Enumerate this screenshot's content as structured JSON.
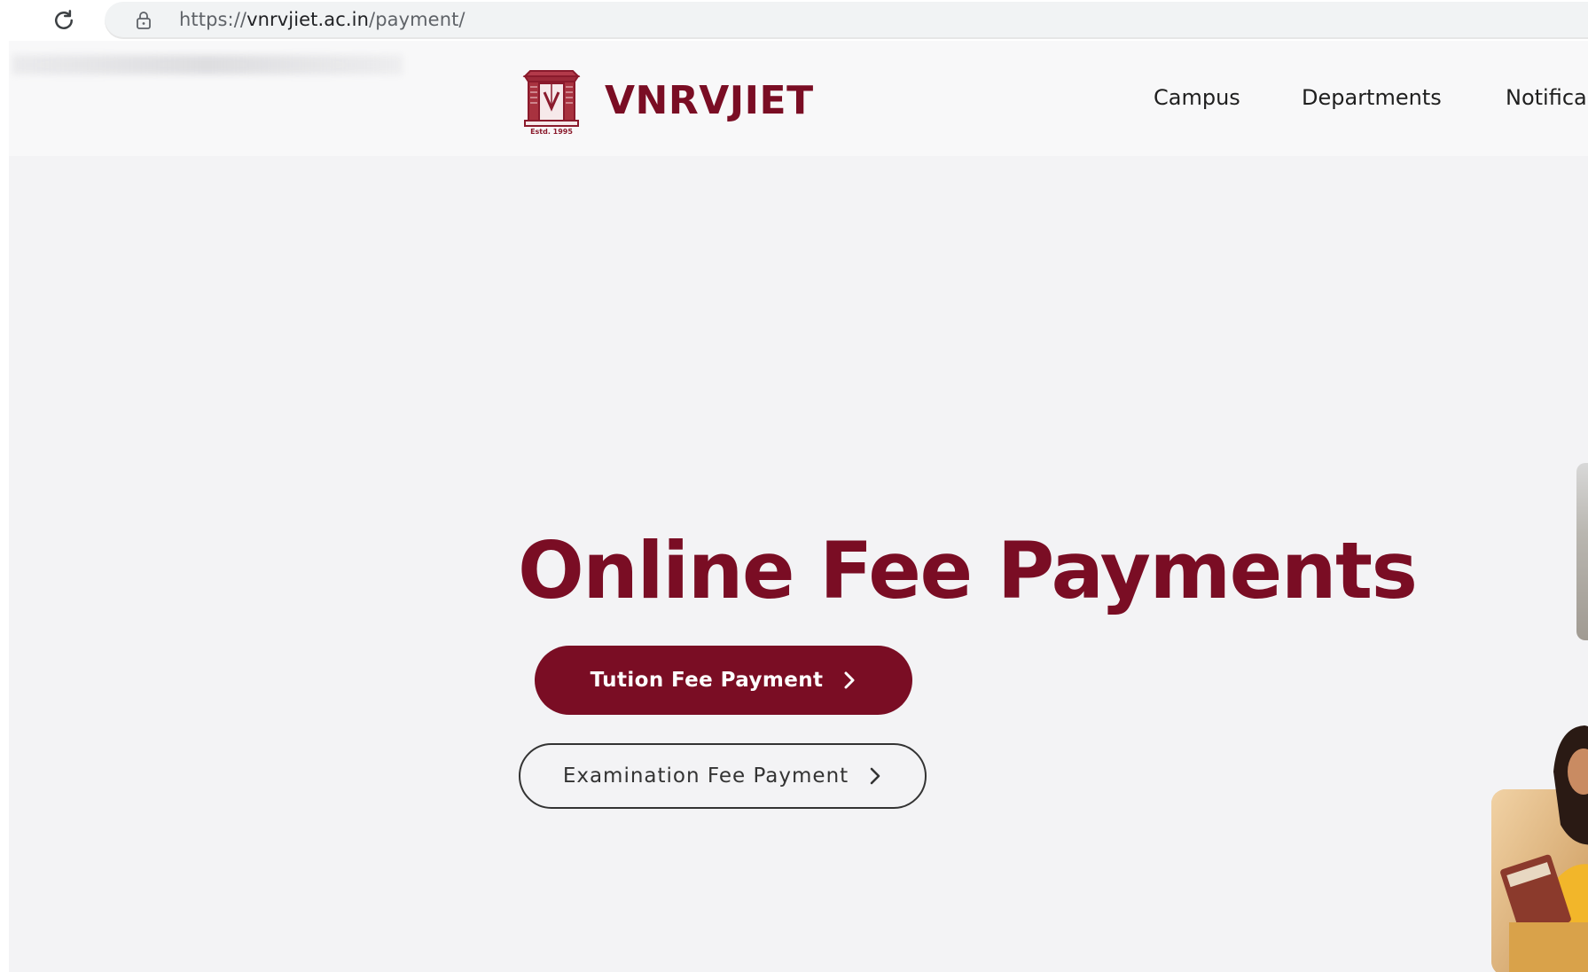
{
  "browser": {
    "url_scheme": "https://",
    "url_host": "vnrvjiet.ac.in",
    "url_path": "/payment/",
    "icons": {
      "reload": "reload-icon",
      "lock": "lock-icon"
    }
  },
  "header": {
    "brand": "VNRVJIET",
    "logo_caption": "Estd. 1995",
    "logo_icon": "college-emblem",
    "nav": [
      {
        "label": "Campus"
      },
      {
        "label": "Departments"
      },
      {
        "label": "Notifica"
      }
    ]
  },
  "hero": {
    "title": "Online Fee Payments",
    "buttons": {
      "tuition": "Tution Fee Payment",
      "examination": "Examination Fee Payment"
    }
  },
  "colors": {
    "brand": "#7a0d24",
    "hero_bg": "#f3f3f5",
    "header_bg": "#f8f8f9"
  }
}
